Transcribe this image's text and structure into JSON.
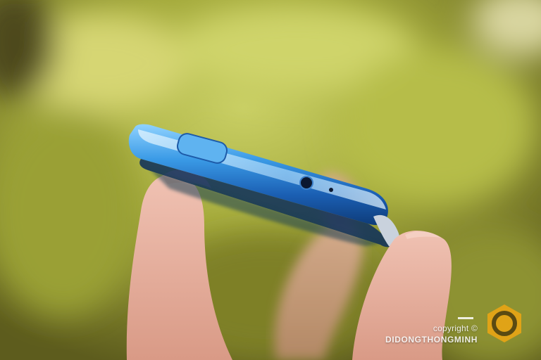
{
  "watermark": {
    "copyright": "copyright ©",
    "site": "DIDONGTHONGMINH",
    "logo_icon": "hexagon-ring-logo-icon",
    "logo_color": "#e0a317"
  },
  "scene": {
    "subject": "phone-top-edge",
    "background_color": "#9aa23a",
    "phone_color": "#2f8fd9"
  }
}
